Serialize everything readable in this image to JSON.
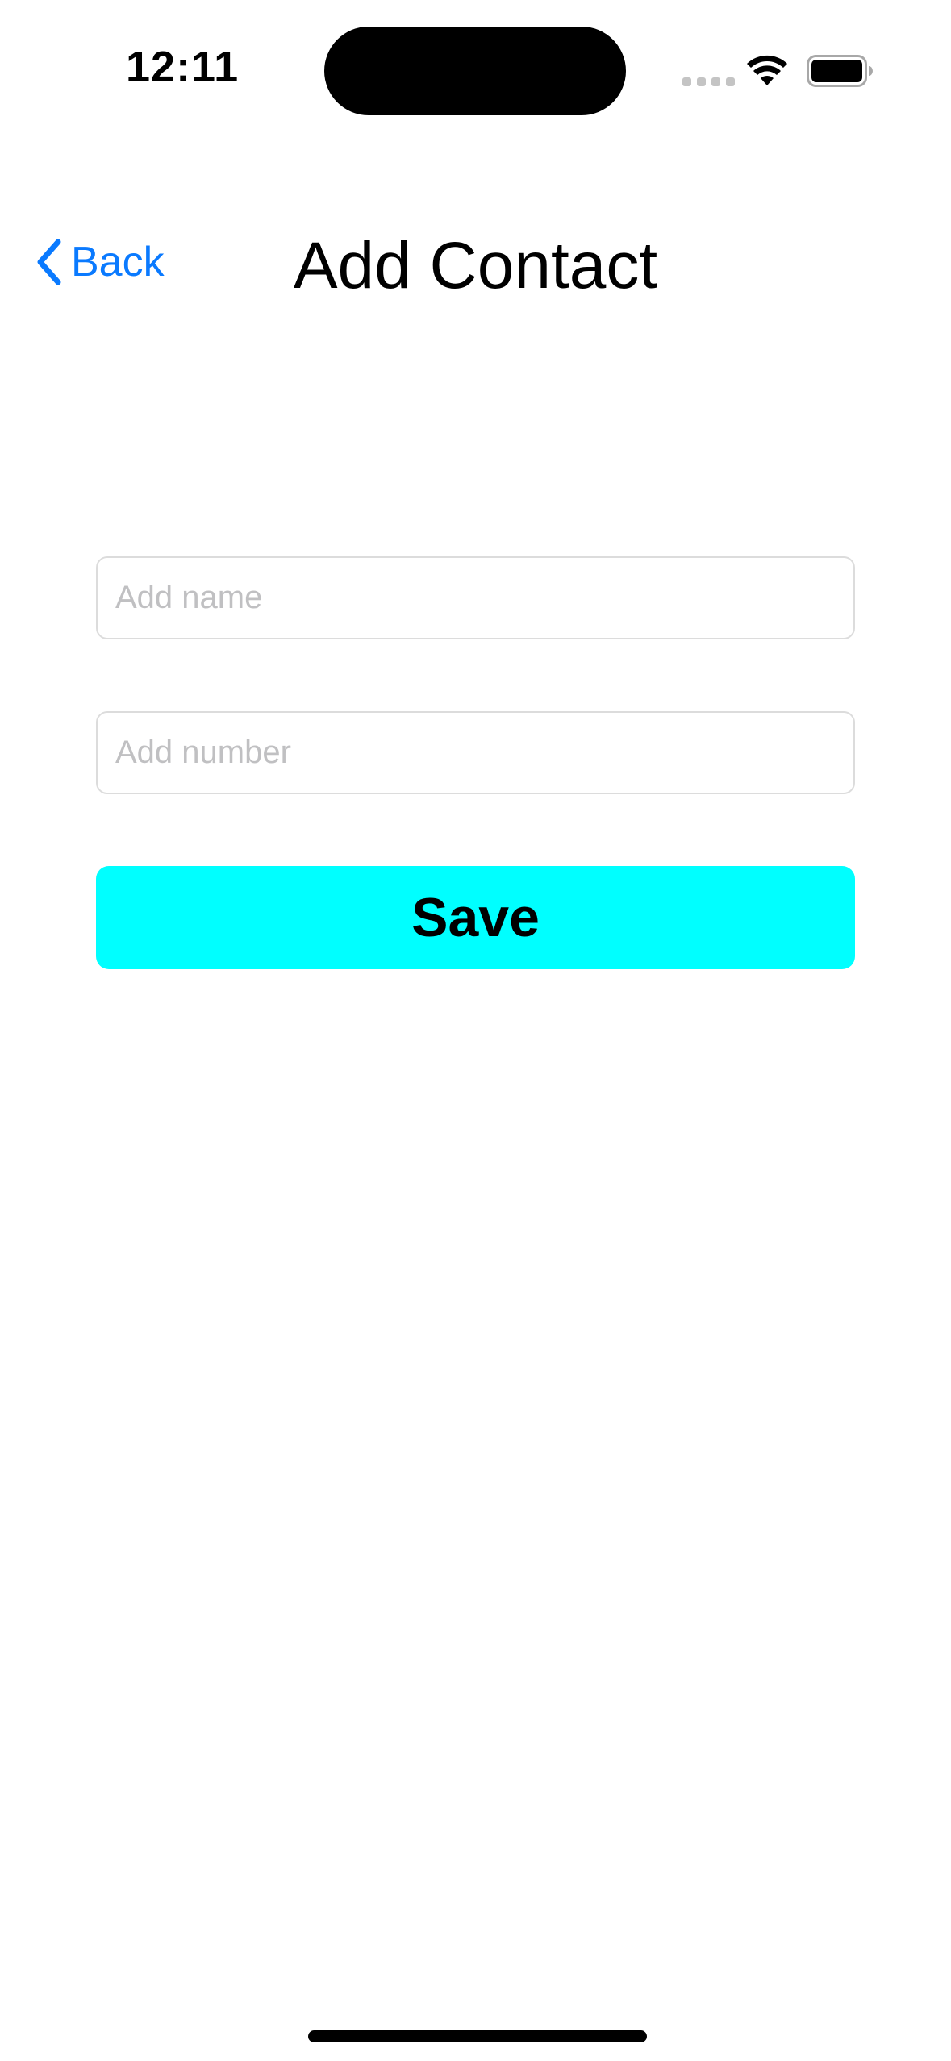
{
  "status_bar": {
    "time": "12:11",
    "icons": [
      "cellular-signal-icon",
      "wifi-icon",
      "battery-icon"
    ]
  },
  "nav": {
    "back_label": "Back",
    "back_icon": "chevron-left-icon",
    "title": "Add Contact"
  },
  "form": {
    "name_field": {
      "value": "",
      "placeholder": "Add name"
    },
    "number_field": {
      "value": "",
      "placeholder": "Add number"
    },
    "save_label": "Save"
  },
  "colors": {
    "accent": "#0a7aff",
    "save_button_bg": "#00ffff",
    "placeholder": "#c0c0c2",
    "field_border": "#dcdcdc"
  }
}
